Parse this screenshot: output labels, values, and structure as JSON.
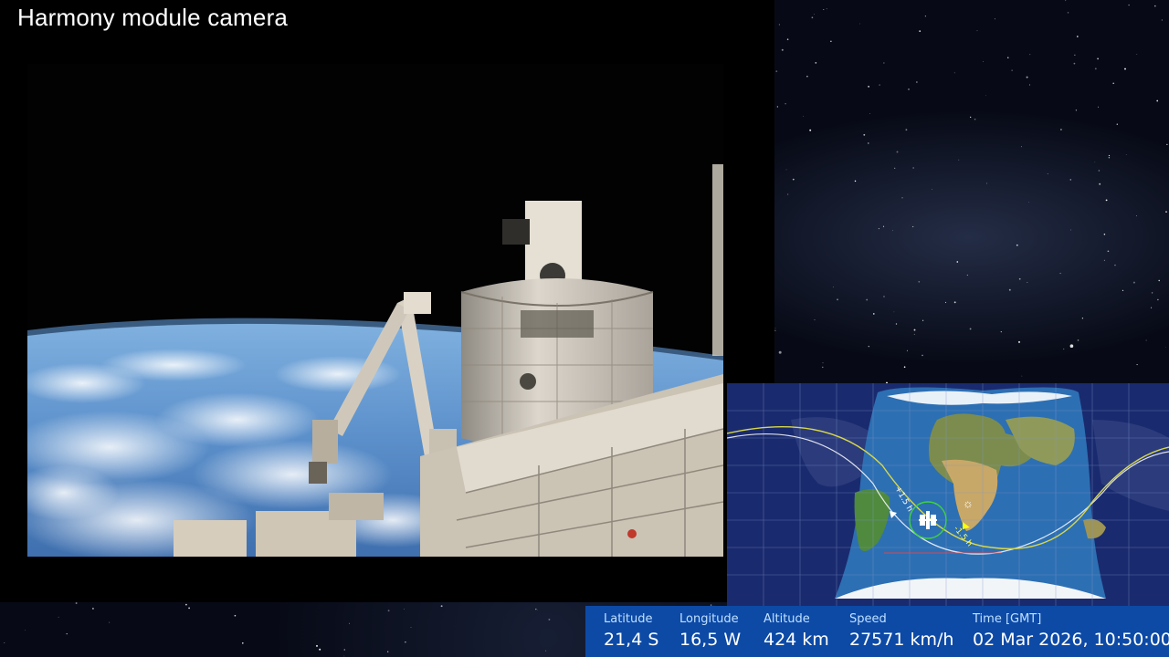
{
  "video": {
    "title": "Harmony module camera"
  },
  "map": {
    "orbit_marker_up": "+1.5 h",
    "orbit_marker_down": "-1.5 h",
    "sun_icon": "sun-icon",
    "station_icon": "iss-icon",
    "colors": {
      "night": "#1a2a6e",
      "day_ocean": "#2d6fb3",
      "ground_track": "#d8d84a",
      "grid": "#7f95c9"
    }
  },
  "telemetry": {
    "latitude": {
      "label": "Latitude",
      "value": "21,4 S"
    },
    "longitude": {
      "label": "Longitude",
      "value": "16,5 W"
    },
    "altitude": {
      "label": "Altitude",
      "value": "424 km"
    },
    "speed": {
      "label": "Speed",
      "value": "27571 km/h"
    },
    "time": {
      "label": "Time [GMT]",
      "value": "02 Mar 2026, 10:50:00"
    }
  }
}
